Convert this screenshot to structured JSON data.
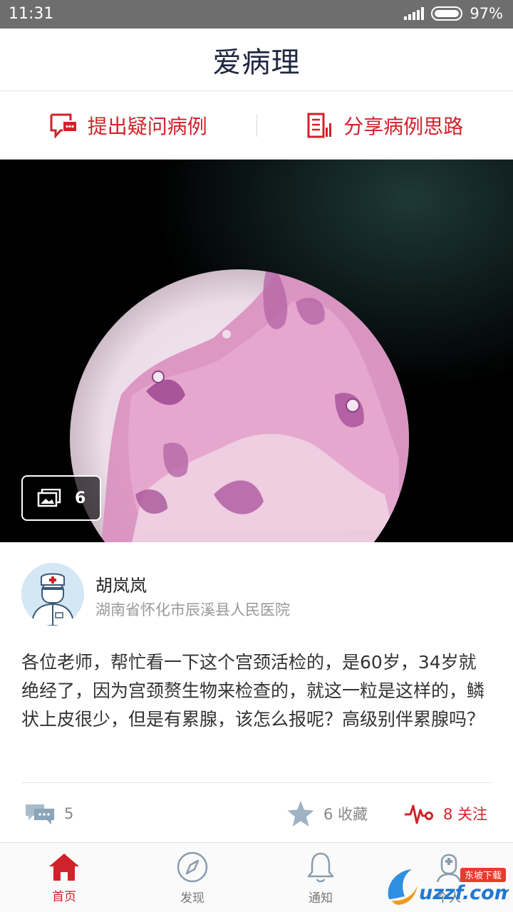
{
  "status_bar": {
    "time": "11:31",
    "battery": "97%"
  },
  "header": {
    "logo": "爱病理"
  },
  "actions": {
    "ask_label": "提出疑问病例",
    "share_label": "分享病例思路"
  },
  "case": {
    "image_count": "6",
    "author_name": "胡岚岚",
    "author_hospital": "湖南省怀化市辰溪县人民医院",
    "body": "各位老师，帮忙看一下这个宫颈活检的，是60岁，34岁就绝经了，因为宫颈赘生物来检查的，就这一粒是这样的，鳞状上皮很少，但是有累腺，该怎么报呢？高级别伴累腺吗？",
    "comments_count": "5",
    "favorites": "6 收藏",
    "follows": "8 关注"
  },
  "bottom_nav": {
    "items": [
      {
        "label": "首页",
        "icon": "home-icon",
        "active": true
      },
      {
        "label": "发现",
        "icon": "compass-icon",
        "active": false
      },
      {
        "label": "通知",
        "icon": "bell-icon",
        "active": false
      },
      {
        "label": "个人",
        "icon": "doctor-icon",
        "active": false
      }
    ]
  },
  "watermark": {
    "text": "uzzf.com",
    "tag": "东坡下载"
  },
  "colors": {
    "accent": "#d0222a",
    "logo": "#1f2740",
    "status_bar": "#6e6e6e"
  }
}
